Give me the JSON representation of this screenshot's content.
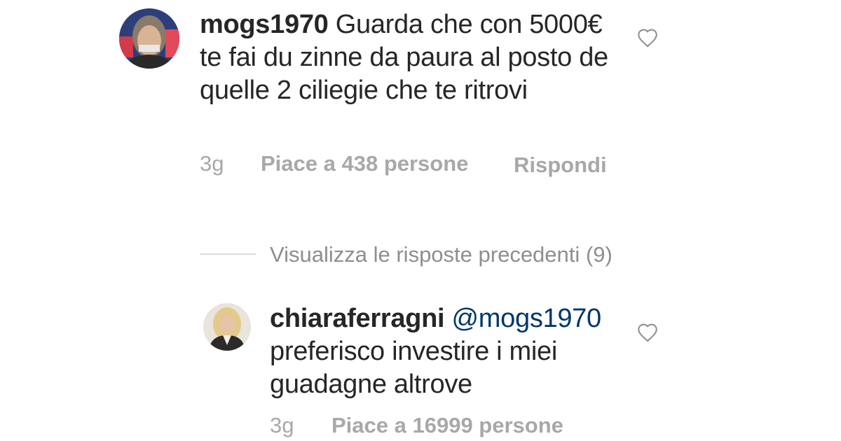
{
  "comments": [
    {
      "username": "mogs1970",
      "text": " Guarda che con 5000€ te fai du zinne da paura al posto de quelle 2 ciliegie che te ritrovi",
      "time": "3g",
      "likes": "Piace a 438 persone",
      "reply_label": "Rispondi",
      "avatar_icon": "user-avatar-icon",
      "like_icon": "heart-outline-icon"
    },
    {
      "username": "chiaraferragni",
      "mention": "@mogs1970",
      "text": "preferisco investire i miei guadagne altrove",
      "time": "3g",
      "likes": "Piace a 16999 persone",
      "avatar_icon": "user-avatar-icon",
      "like_icon": "heart-outline-icon"
    }
  ],
  "replies_toggle": {
    "label": "Visualizza le risposte precedenti (9)"
  },
  "colors": {
    "text": "#262626",
    "meta": "#a8a8a8",
    "mention": "#00376b",
    "divider": "#dbdbdb"
  }
}
